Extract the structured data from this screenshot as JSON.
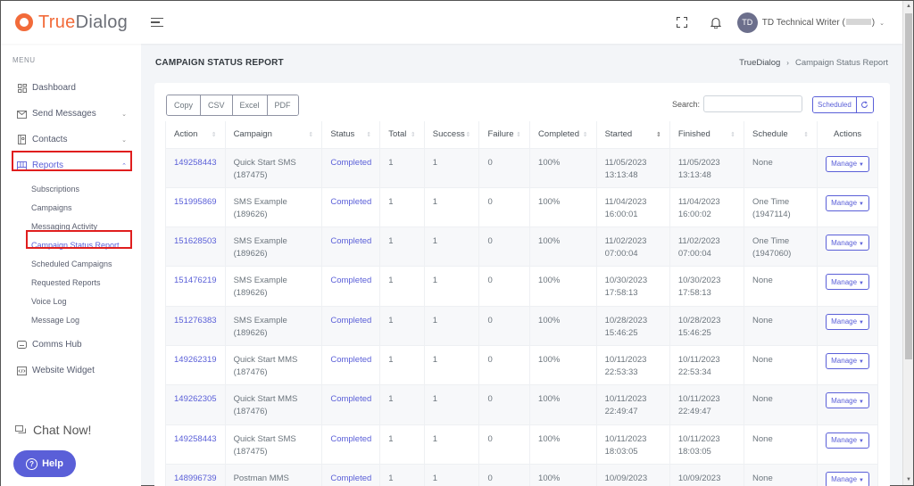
{
  "app": {
    "brand_true": "True",
    "brand_dialog": "Dialog"
  },
  "topbar": {
    "avatar_initials": "TD",
    "user_name": "TD Technical Writer (",
    "user_name_suffix": ")"
  },
  "sidebar": {
    "menu_title": "MENU",
    "items": [
      {
        "label": "Dashboard",
        "icon": "dashboard-icon"
      },
      {
        "label": "Send Messages",
        "icon": "send-messages-icon"
      },
      {
        "label": "Contacts",
        "icon": "contacts-icon"
      },
      {
        "label": "Reports",
        "icon": "reports-icon"
      }
    ],
    "report_sub_items": [
      {
        "label": "Subscriptions"
      },
      {
        "label": "Campaigns"
      },
      {
        "label": "Messaging Activity"
      },
      {
        "label": "Campaign Status Report"
      },
      {
        "label": "Scheduled Campaigns"
      },
      {
        "label": "Requested Reports"
      },
      {
        "label": "Voice Log"
      },
      {
        "label": "Message Log"
      }
    ],
    "bottom_items": [
      {
        "label": "Comms Hub",
        "icon": "comms-hub-icon"
      },
      {
        "label": "Website Widget",
        "icon": "website-widget-icon"
      }
    ],
    "chat_now": "Chat Now!",
    "help": "Help",
    "highlight_color": "#e01e1e",
    "accent_color": "#5a5fd8"
  },
  "page": {
    "title": "CAMPAIGN STATUS REPORT",
    "breadcrumb": [
      "TrueDialog",
      "Campaign Status Report"
    ]
  },
  "toolbar": {
    "export_buttons": [
      "Copy",
      "CSV",
      "Excel",
      "PDF"
    ],
    "search_label": "Search:",
    "search_value": "",
    "scheduled_label": "Scheduled"
  },
  "table": {
    "columns": [
      "Action",
      "Campaign",
      "Status",
      "Total",
      "Success",
      "Failure",
      "Completed",
      "Started",
      "Finished",
      "Schedule",
      "Actions"
    ],
    "manage_label": "Manage",
    "rows": [
      {
        "action": "149258443",
        "campaign": "Quick Start SMS",
        "campaign_id": "(187475)",
        "status": "Completed",
        "total": "1",
        "success": "1",
        "failure": "0",
        "completed": "100%",
        "started_date": "11/05/2023",
        "started_time": "13:13:48",
        "finished_date": "11/05/2023",
        "finished_time": "13:13:48",
        "schedule": "None",
        "schedule_id": ""
      },
      {
        "action": "151995869",
        "campaign": "SMS Example",
        "campaign_id": "(189626)",
        "status": "Completed",
        "total": "1",
        "success": "1",
        "failure": "0",
        "completed": "100%",
        "started_date": "11/04/2023",
        "started_time": "16:00:01",
        "finished_date": "11/04/2023",
        "finished_time": "16:00:02",
        "schedule": "One Time",
        "schedule_id": "(1947114)"
      },
      {
        "action": "151628503",
        "campaign": "SMS Example",
        "campaign_id": "(189626)",
        "status": "Completed",
        "total": "1",
        "success": "1",
        "failure": "0",
        "completed": "100%",
        "started_date": "11/02/2023",
        "started_time": "07:00:04",
        "finished_date": "11/02/2023",
        "finished_time": "07:00:04",
        "schedule": "One Time",
        "schedule_id": "(1947060)"
      },
      {
        "action": "151476219",
        "campaign": "SMS Example",
        "campaign_id": "(189626)",
        "status": "Completed",
        "total": "1",
        "success": "1",
        "failure": "0",
        "completed": "100%",
        "started_date": "10/30/2023",
        "started_time": "17:58:13",
        "finished_date": "10/30/2023",
        "finished_time": "17:58:13",
        "schedule": "None",
        "schedule_id": ""
      },
      {
        "action": "151276383",
        "campaign": "SMS Example",
        "campaign_id": "(189626)",
        "status": "Completed",
        "total": "1",
        "success": "1",
        "failure": "0",
        "completed": "100%",
        "started_date": "10/28/2023",
        "started_time": "15:46:25",
        "finished_date": "10/28/2023",
        "finished_time": "15:46:25",
        "schedule": "None",
        "schedule_id": ""
      },
      {
        "action": "149262319",
        "campaign": "Quick Start MMS",
        "campaign_id": "(187476)",
        "status": "Completed",
        "total": "1",
        "success": "1",
        "failure": "0",
        "completed": "100%",
        "started_date": "10/11/2023",
        "started_time": "22:53:33",
        "finished_date": "10/11/2023",
        "finished_time": "22:53:34",
        "schedule": "None",
        "schedule_id": ""
      },
      {
        "action": "149262305",
        "campaign": "Quick Start MMS",
        "campaign_id": "(187476)",
        "status": "Completed",
        "total": "1",
        "success": "1",
        "failure": "0",
        "completed": "100%",
        "started_date": "10/11/2023",
        "started_time": "22:49:47",
        "finished_date": "10/11/2023",
        "finished_time": "22:49:47",
        "schedule": "None",
        "schedule_id": ""
      },
      {
        "action": "149258443",
        "campaign": "Quick Start SMS",
        "campaign_id": "(187475)",
        "status": "Completed",
        "total": "1",
        "success": "1",
        "failure": "0",
        "completed": "100%",
        "started_date": "10/11/2023",
        "started_time": "18:03:05",
        "finished_date": "10/11/2023",
        "finished_time": "18:03:05",
        "schedule": "None",
        "schedule_id": ""
      },
      {
        "action": "148996739",
        "campaign": "Postman MMS Testing",
        "campaign_id": "",
        "status": "Completed",
        "total": "1",
        "success": "1",
        "failure": "0",
        "completed": "100%",
        "started_date": "10/09/2023",
        "started_time": "",
        "finished_date": "10/09/2023",
        "finished_time": "",
        "schedule": "None",
        "schedule_id": ""
      }
    ]
  }
}
